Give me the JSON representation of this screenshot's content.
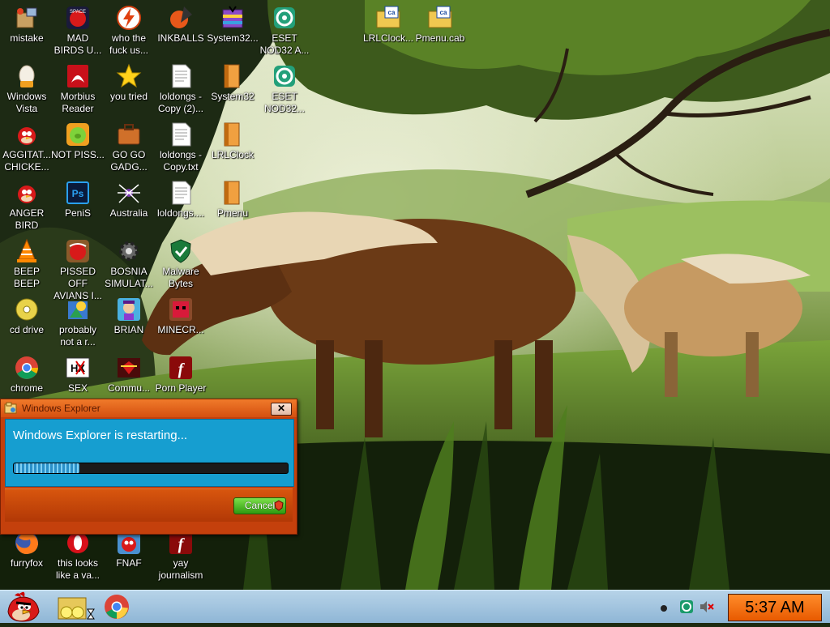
{
  "desktop": {
    "icons": [
      {
        "label": "mistake",
        "icon": "installer-box-icon"
      },
      {
        "label": "MAD BIRDS U...",
        "icon": "angry-birds-space-icon"
      },
      {
        "label": "who the fuck us...",
        "icon": "lightning-app-icon"
      },
      {
        "label": "INKBALLS",
        "icon": "inkball-icon"
      },
      {
        "label": "System32...",
        "icon": "winrar-archive-icon"
      },
      {
        "label": "ESET NOD32 A...",
        "icon": "eset-icon"
      },
      {
        "label": "LRLClock...",
        "icon": "cab-file-icon"
      },
      {
        "label": "Pmenu.cab",
        "icon": "cab-file-icon"
      },
      {
        "label": "Windows Vista",
        "icon": "egg-icon"
      },
      {
        "label": "Morbius Reader",
        "icon": "pdf-reader-icon"
      },
      {
        "label": "you tried",
        "icon": "star-icon"
      },
      {
        "label": "loldongs - Copy (2)...",
        "icon": "text-file-icon"
      },
      {
        "label": "System32",
        "icon": "folder-book-icon"
      },
      {
        "label": "ESET NOD32...",
        "icon": "eset-icon"
      },
      {
        "label": "AGGITAT... CHICKE...",
        "icon": "angry-bird-icon"
      },
      {
        "label": "NOT PISS...",
        "icon": "bad-piggies-icon"
      },
      {
        "label": "GO GO GADG...",
        "icon": "briefcase-icon"
      },
      {
        "label": "loldongs - Copy.txt",
        "icon": "text-file-icon"
      },
      {
        "label": "LRLClock",
        "icon": "folder-book-icon"
      },
      {
        "label": "ANGER BIRD",
        "icon": "angry-bird-icon"
      },
      {
        "label": "PeniS",
        "icon": "photoshop-icon"
      },
      {
        "label": "Australia",
        "icon": "spider-icon"
      },
      {
        "label": "loldongs....",
        "icon": "text-file-icon"
      },
      {
        "label": "Pmenu",
        "icon": "folder-book-icon"
      },
      {
        "label": "BEEP BEEP",
        "icon": "vlc-cone-icon"
      },
      {
        "label": "PISSED OFF AVIANS I...",
        "icon": "angry-birds-app-icon"
      },
      {
        "label": "BOSNIA SIMULAT...",
        "icon": "gear-icon"
      },
      {
        "label": "Malware Bytes",
        "icon": "shield-icon"
      },
      {
        "label": "cd drive",
        "icon": "cd-icon"
      },
      {
        "label": "probably not a r...",
        "icon": "setup-icon"
      },
      {
        "label": "BRIAN",
        "icon": "character-icon"
      },
      {
        "label": "MINECR...",
        "icon": "minecraft-icon"
      },
      {
        "label": "chrome",
        "icon": "chrome-icon"
      },
      {
        "label": "SEX",
        "icon": "hex-editor-icon"
      },
      {
        "label": "Commu...",
        "icon": "communist-icon"
      },
      {
        "label": "Porn Player",
        "icon": "flash-player-icon"
      },
      {
        "label": "furryfox",
        "icon": "firefox-icon"
      },
      {
        "label": "this looks like a va...",
        "icon": "opera-icon"
      },
      {
        "label": "FNAF",
        "icon": "angry-bird-small-icon"
      },
      {
        "label": "yay journalism",
        "icon": "flash-player-icon"
      }
    ]
  },
  "dialog": {
    "title": "Windows Explorer",
    "message": "Windows Explorer is restarting...",
    "progress_fraction": 0.24,
    "close_label": "✕",
    "cancel_label": "Cancel"
  },
  "taskbar": {
    "start_icon": "angry-bird-start-icon",
    "quick_launch": [
      "folder-chicks-icon",
      "chrome-icon"
    ],
    "tray": [
      "dot-icon",
      "eset-tray-icon",
      "volume-muted-icon"
    ],
    "clock": "5:37 AM"
  },
  "colors": {
    "dialog_frame": "#c4400c",
    "dialog_body": "#169ed0",
    "clock_bg": "#f07010",
    "taskbar": "#a6c7e0"
  }
}
